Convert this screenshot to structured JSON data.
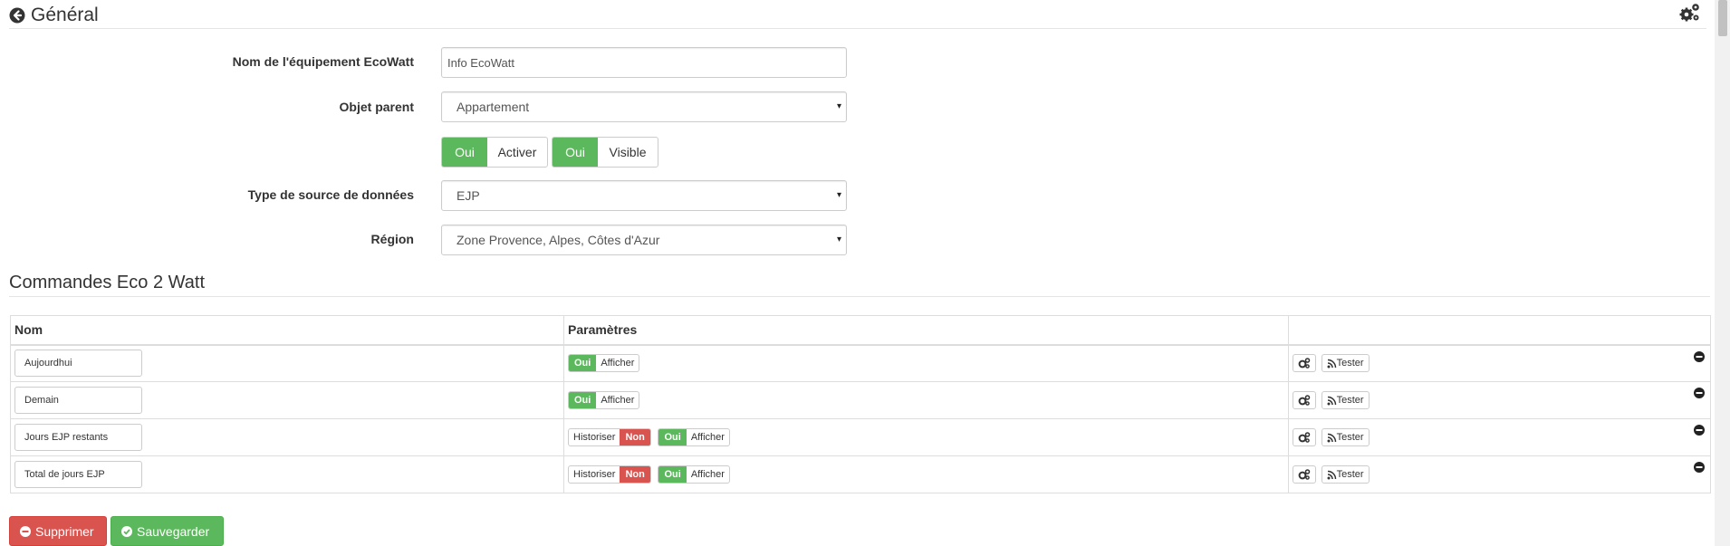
{
  "header": {
    "title": "Général",
    "back_icon": "arrow-circle-left-icon",
    "config_icon": "gears-icon"
  },
  "form": {
    "name_label": "Nom de l'équipement EcoWatt",
    "name_value": "Info EcoWatt",
    "parent_label": "Objet parent",
    "parent_value": "Appartement",
    "enable_on": "Oui",
    "enable_label": "Activer",
    "visible_on": "Oui",
    "visible_label": "Visible",
    "source_label": "Type de source de données",
    "source_value": "EJP",
    "region_label": "Région",
    "region_value": "Zone Provence, Alpes, Côtes d'Azur",
    "select_arrow": "▾"
  },
  "commands": {
    "section_title": "Commandes Eco 2 Watt",
    "col_nom": "Nom",
    "col_params": "Paramètres",
    "rows": [
      {
        "name": "Aujourdhui",
        "historiser_label": "",
        "historiser_state": "",
        "afficher_on": "Oui",
        "afficher_label": "Afficher",
        "tester_label": "Tester"
      },
      {
        "name": "Demain",
        "historiser_label": "",
        "historiser_state": "",
        "afficher_on": "Oui",
        "afficher_label": "Afficher",
        "tester_label": "Tester"
      },
      {
        "name": "Jours EJP restants",
        "historiser_label": "Historiser",
        "historiser_state": "Non",
        "afficher_on": "Oui",
        "afficher_label": "Afficher",
        "tester_label": "Tester"
      },
      {
        "name": "Total de jours EJP",
        "historiser_label": "Historiser",
        "historiser_state": "Non",
        "afficher_on": "Oui",
        "afficher_label": "Afficher",
        "tester_label": "Tester"
      }
    ]
  },
  "actions": {
    "delete_label": "Supprimer",
    "save_label": "Sauvegarder"
  },
  "colors": {
    "success": "#5cb85c",
    "danger": "#d9534f"
  }
}
